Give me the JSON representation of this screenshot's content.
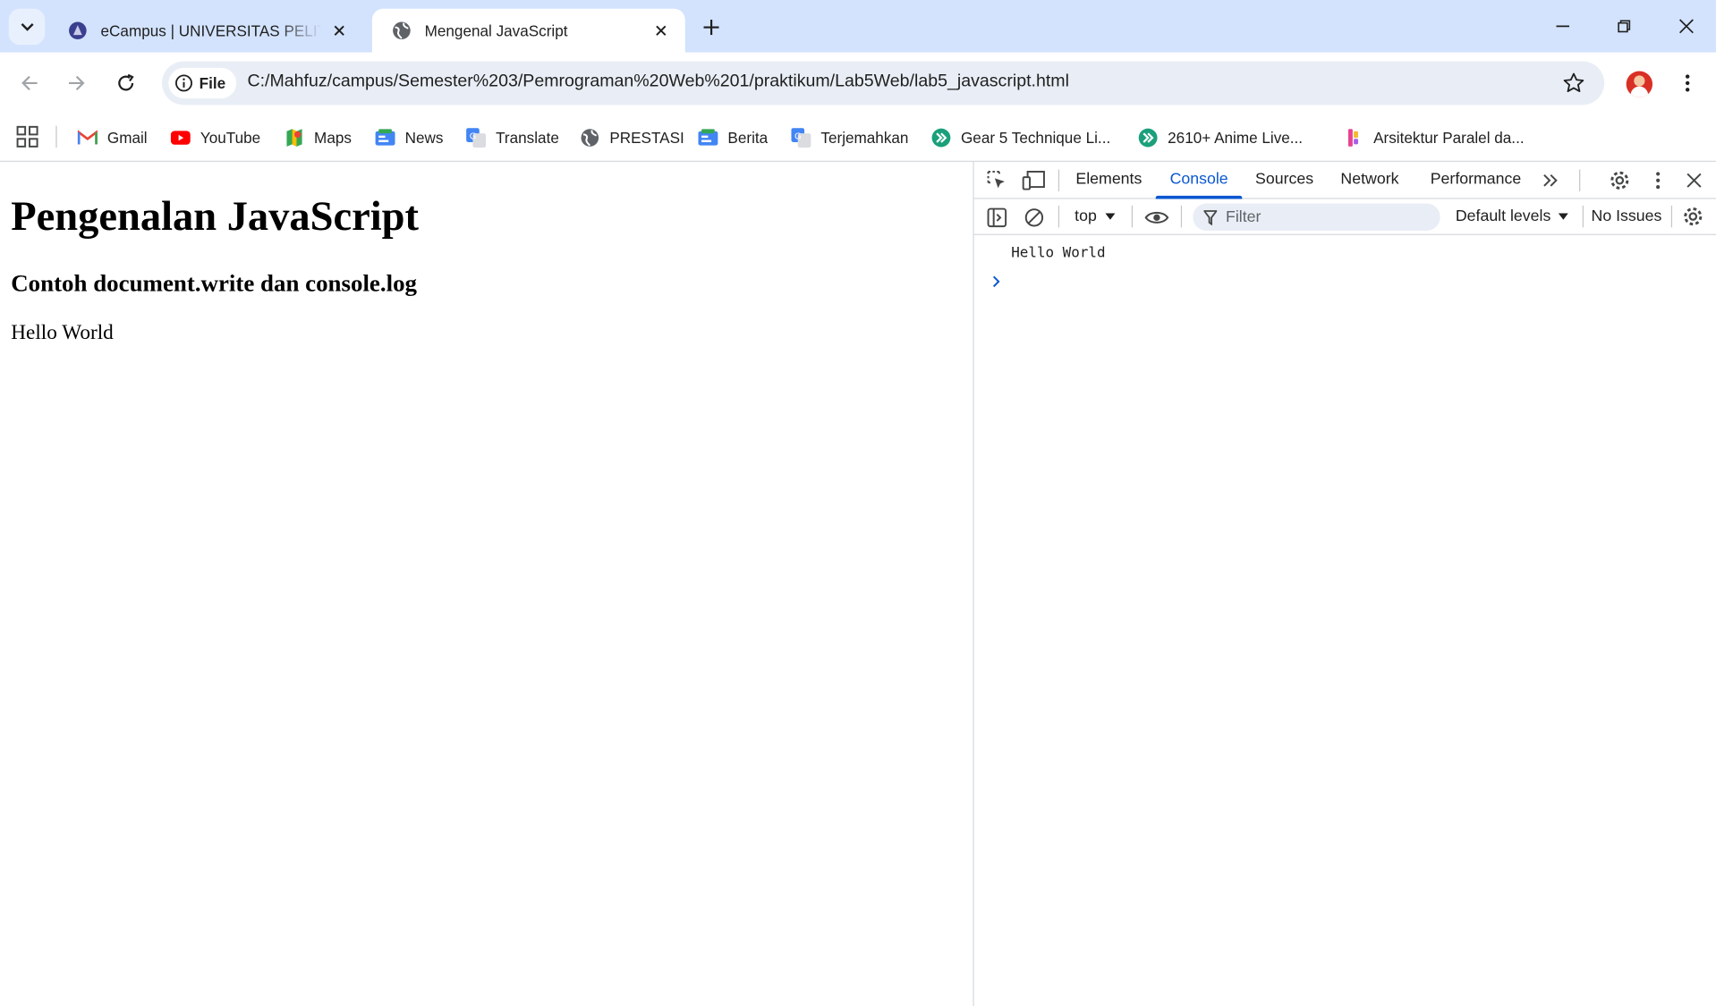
{
  "browser": {
    "tabs": [
      {
        "title": "eCampus | UNIVERSITAS PELITA",
        "active": false
      },
      {
        "title": "Mengenal JavaScript",
        "active": true
      }
    ],
    "address_chip": "File",
    "url": "C:/Mahfuz/campus/Semester%203/Pemrograman%20Web%201/praktikum/Lab5Web/lab5_javascript.html",
    "bookmarks": [
      "Gmail",
      "YouTube",
      "Maps",
      "News",
      "Translate",
      "PRESTASI",
      "Berita",
      "Terjemahkan",
      "Gear 5 Technique Li...",
      "2610+ Anime Live...",
      "Arsitektur Paralel da..."
    ]
  },
  "page": {
    "heading": "Pengenalan JavaScript",
    "subheading": "Contoh document.write dan console.log",
    "body_text": "Hello World"
  },
  "devtools": {
    "tabs": [
      "Elements",
      "Console",
      "Sources",
      "Network",
      "Performance"
    ],
    "active_tab": "Console",
    "context": "top",
    "filter_placeholder": "Filter",
    "levels": "Default levels",
    "issues": "No Issues",
    "console_output": [
      "Hello World"
    ]
  },
  "colors": {
    "tabstrip": "#d3e3fd",
    "accent": "#0b57d0",
    "omnibox": "#e9eef6"
  }
}
